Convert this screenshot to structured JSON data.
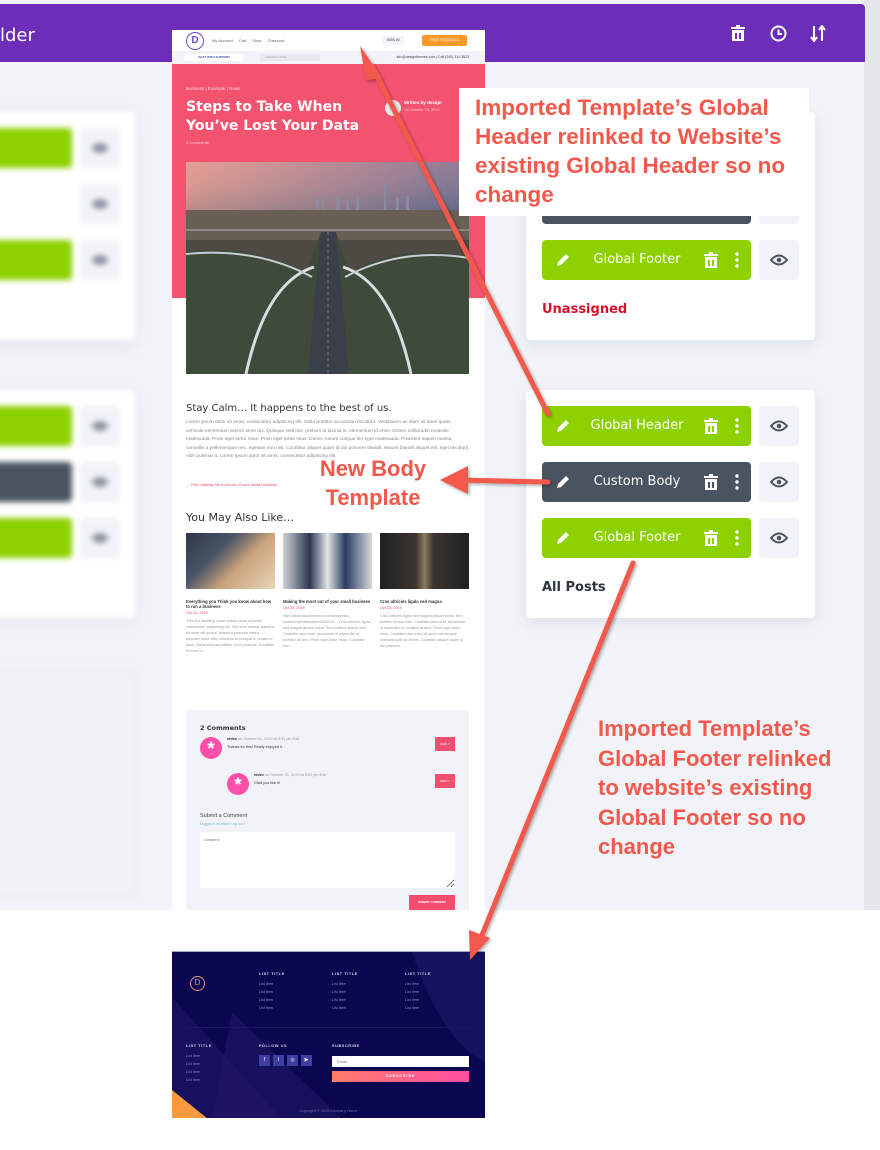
{
  "builder": {
    "title_partial": "lder",
    "toolbar_icons": [
      "trash-icon",
      "history-clock-icon",
      "sort-arrows-icon"
    ],
    "accent_color": "#6c2eb9",
    "green_color": "#8ed100",
    "dark_color": "#4a5461"
  },
  "template_cards": [
    {
      "rows": [
        {
          "label": "Global Footer",
          "style": "green"
        }
      ],
      "assignment": "Unassigned",
      "assignment_color": "#d8102e"
    },
    {
      "rows": [
        {
          "label": "Global Header",
          "style": "green"
        },
        {
          "label": "Custom Body",
          "style": "dark"
        },
        {
          "label": "Global Footer",
          "style": "green"
        }
      ],
      "assignment": "All Posts"
    }
  ],
  "preview": {
    "header": {
      "logo": "D",
      "nav": [
        "My Account",
        "Cart",
        "Shop",
        "Checkout"
      ],
      "sign_in": "SIGN IN",
      "cta": "FREE PACKAGES",
      "chat": "CHAT WITH SUPPORT",
      "search_placeholder": "SEARCH SITE",
      "contact": "info@designthemes.com  |  Call (240) 314-3523"
    },
    "hero": {
      "breadcrumb": "Business | Example | News",
      "title": "Steps to Take When You’ve Lost Your Data",
      "comments": "2 Comments",
      "written_by": "Written by design",
      "date": "On October 23, 2019"
    },
    "body": {
      "heading": "Stay Calm… It happens to the best of us.",
      "paragraph": "Lorem ipsum dolor sit amet, consectetur adipiscing elit. Nulla porttitor accumsan tincidunt. Vestibulum ac diam sit amet quam vehicula elementum sed sit amet dui. Quisque velit nisi, pretium ut lacinia in, elementum id enim. Donec sollicitudin molestie malesuada. Proin eget tortor risus. Proin eget tortor risus. Donec rutrum congue leo eget malesuada. Praesent sapien massa, convallis a pellentesque nec, egestas non nisi. Curabitur aliquet quam id dui posuere blandit. Mauris blandit aliquet elit, eget tincidunt nibh pulvinar a. Lorem ipsum dolor sit amet, consectetur adipiscing elit.",
      "prev_link": "← Prev Making the most out of your small business",
      "related_heading": "You May Also Like…",
      "related": [
        {
          "title": "Everything you Think you know about how to run a business",
          "date": "Oct 23, 2019",
          "excerpt": "This is a heading Lorem ipsum dolor sit amet, consectetur adipiscing elit. Sed arcu massa, dapibus sit amet elit auctor, pharetra pharetra metus. Aliquam dolor odio, faucibus id volutpat a, ornare id diam. Nulla tempus porttitor mi id vehicula. Curabitur et nunc m..."
        },
        {
          "title": "Making the most out of your small business",
          "date": "Oct 23, 2019",
          "excerpt": "http://peon.sandboxdev.com/design/wp-content/uploads/sites/20/2019/... Cras ultricies ligula sed magna dictum porta. Sed porttitor lectus nibh. Curabitur arcu erat, accumsan id imperdiet et, porttitor at sem. Proin eget tortor risus. Curabitur non..."
        },
        {
          "title": "Cras ultricies ligula sed magna",
          "date": "Oct 23, 2019",
          "excerpt": "Cras ultricies ligula sed magna dictum porta. Sed porttitor lectus nibh. Curabitur arcu erat, accumsan id imperdiet et, porttitor at sem. Proin eget tortor risus. Curabitur non nulla sit amet nisl tempus convallis quis ac lectus. Curabitur aliquet quam id dui posuere..."
        }
      ]
    },
    "comments": {
      "title": "2 Comments",
      "items": [
        {
          "author": "etdev",
          "meta": "on October 31, 2019 at 5:01 pm",
          "edit": "Edit",
          "text": "Thanks for this! Really enjoyed it.",
          "reply": "REPLY"
        },
        {
          "author": "etdev",
          "meta": "on October 31, 2019 at 5:02 pm",
          "edit": "Edit",
          "text": "Glad you like it!",
          "reply": "REPLY"
        }
      ],
      "submit_title": "Submit a Comment",
      "logged_in": "Logged in as etdev. Log out?",
      "comment_placeholder": "Comment",
      "submit_button": "SUBMIT COMMENT"
    },
    "footer": {
      "logo": "D",
      "columns": [
        {
          "title": "LIST TITLE",
          "items": [
            "List Item",
            "List Item",
            "List Item",
            "List Item"
          ]
        },
        {
          "title": "LIST TITLE",
          "items": [
            "List Item",
            "List Item",
            "List Item",
            "List Item"
          ]
        },
        {
          "title": "LIST TITLE",
          "items": [
            "List Item",
            "List Item",
            "List Item",
            "List Item"
          ]
        },
        {
          "title": "LIST TITLE",
          "items": [
            "List Item",
            "List Item",
            "List Item",
            "List Item"
          ]
        }
      ],
      "follow_title": "FOLLOW US",
      "social": [
        "f",
        "t",
        "◎",
        "▶"
      ],
      "subscribe_title": "SUBSCRIBE",
      "email_placeholder": "Email",
      "subscribe_button": "SUBSCRIBE",
      "copyright": "Copyright © 2019 Company Name"
    }
  },
  "annotations": {
    "header_note": "Imported Template’s Global Header relinked to Website’s existing Global Header so no change",
    "body_note": "New Body Template",
    "footer_note": "Imported Template’s Global Footer relinked to website’s existing Global Footer so no change",
    "color": "#f2584b"
  }
}
